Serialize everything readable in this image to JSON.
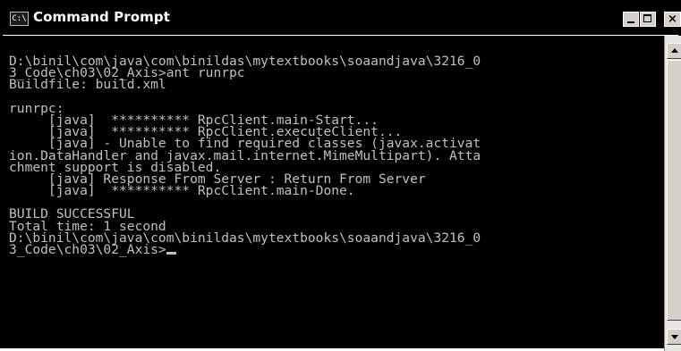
{
  "window": {
    "icon_text": "C:\\",
    "title": "Command Prompt"
  },
  "console": {
    "lines": [
      "D:\\binil\\com\\java\\com\\binildas\\mytextbooks\\soaandjava\\3216_0",
      "3_Code\\ch03\\02_Axis>ant runrpc",
      "Buildfile: build.xml",
      "",
      "runrpc:",
      "     [java]  ********** RpcClient.main-Start...",
      "     [java]  ********** RpcClient.executeClient...",
      "     [java] - Unable to find required classes (javax.activat",
      "ion.DataHandler and javax.mail.internet.MimeMultipart). Atta",
      "chment support is disabled.",
      "     [java] Response From Server : Return From Server",
      "     [java]  ********** RpcClient.main-Done.",
      "",
      "BUILD SUCCESSFUL",
      "Total time: 1 second",
      "D:\\binil\\com\\java\\com\\binildas\\mytextbooks\\soaandjava\\3216_0",
      "3_Code\\ch03\\02_Axis>"
    ]
  },
  "colors": {
    "console_bg": "#000000",
    "console_text": "#c0c0c0"
  },
  "icons": {
    "app": "cmd-prompt-icon",
    "minimize": "minimize-icon",
    "maximize": "maximize-icon",
    "close": "close-icon"
  }
}
